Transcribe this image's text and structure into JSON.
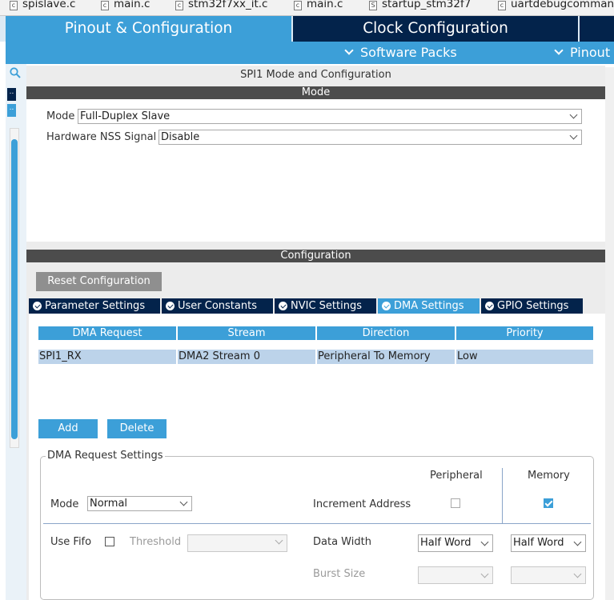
{
  "file_tabs": [
    {
      "icon": "c-file-icon",
      "glyph": "c",
      "label": "spislave.c"
    },
    {
      "icon": "c-file-icon",
      "glyph": "c",
      "label": "main.c"
    },
    {
      "icon": "c-file-icon",
      "glyph": "c",
      "label": "stm32f7xx_it.c"
    },
    {
      "icon": "c-file-icon",
      "glyph": "c",
      "label": "main.c"
    },
    {
      "icon": "s-file-icon",
      "glyph": "S",
      "label": "startup_stm32f7"
    },
    {
      "icon": "c-file-icon",
      "glyph": "c",
      "label": "uartdebugcomman"
    }
  ],
  "nav": {
    "pinout_config": "Pinout & Configuration",
    "clock_config": "Clock Configuration",
    "software_packs": "Software Packs",
    "pinout": "Pinout"
  },
  "left_strip": {
    "tab1": "..",
    "tab2": ".."
  },
  "panel": {
    "title": "SPI1 Mode and Configuration",
    "mode_header": "Mode",
    "mode_label": "Mode",
    "mode_value": "Full-Duplex Slave",
    "nss_label": "Hardware NSS Signal",
    "nss_value": "Disable",
    "config_header": "Configuration",
    "reset_button": "Reset Configuration"
  },
  "config_tabs": [
    {
      "label": "Parameter Settings",
      "active": false
    },
    {
      "label": "User Constants",
      "active": false
    },
    {
      "label": "NVIC Settings",
      "active": false
    },
    {
      "label": "DMA Settings",
      "active": true
    },
    {
      "label": "GPIO Settings",
      "active": false
    }
  ],
  "dma_table": {
    "columns": [
      "DMA Request",
      "Stream",
      "Direction",
      "Priority"
    ],
    "rows": [
      [
        "SPI1_RX",
        "DMA2 Stream 0",
        "Peripheral To Memory",
        "Low"
      ]
    ]
  },
  "buttons": {
    "add": "Add",
    "delete": "Delete"
  },
  "request_settings": {
    "legend": "DMA Request Settings",
    "peripheral_header": "Peripheral",
    "memory_header": "Memory",
    "mode_label": "Mode",
    "mode_value": "Normal",
    "increment_label": "Increment Address",
    "peripheral_increment": false,
    "memory_increment": true,
    "use_fifo_label": "Use Fifo",
    "use_fifo": false,
    "threshold_label": "Threshold",
    "threshold_value": "",
    "data_width_label": "Data Width",
    "peripheral_data_width": "Half Word",
    "memory_data_width": "Half Word",
    "burst_size_label": "Burst Size",
    "peripheral_burst": "",
    "memory_burst": ""
  },
  "colors": {
    "primary_blue": "#3c9fd8",
    "navy": "#03234b",
    "header_gray": "#4c4c4c",
    "selected_row": "#bcd3ea"
  }
}
